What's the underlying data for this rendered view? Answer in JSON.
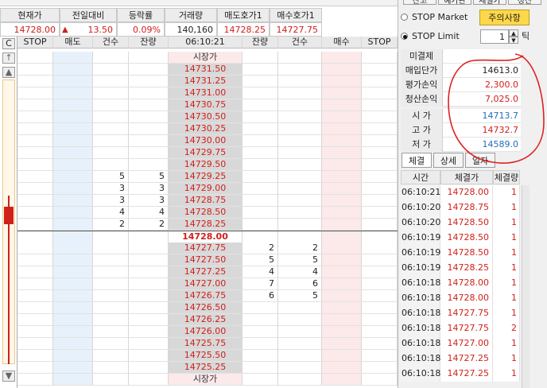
{
  "quote": {
    "headers": [
      "현재가",
      "전일대비",
      "등락률",
      "거래량",
      "매도호가1",
      "매수호가1"
    ],
    "current_price": "14728.00",
    "change_arrow": "▲",
    "change": "13.50",
    "change_rate": "0.09%",
    "volume": "140,160",
    "ask1": "14728.25",
    "bid1": "14727.75"
  },
  "orderbook": {
    "headers": [
      "STOP",
      "매도",
      "건수",
      "잔량",
      "06:10:21",
      "잔량",
      "건수",
      "매수",
      "STOP"
    ],
    "market_label": "시장가",
    "side_c_label": "C",
    "current": "14728.00",
    "asks": [
      {
        "price": "14731.50",
        "count": "",
        "qty": ""
      },
      {
        "price": "14731.25",
        "count": "",
        "qty": ""
      },
      {
        "price": "14731.00",
        "count": "",
        "qty": ""
      },
      {
        "price": "14730.75",
        "count": "",
        "qty": ""
      },
      {
        "price": "14730.50",
        "count": "",
        "qty": ""
      },
      {
        "price": "14730.25",
        "count": "",
        "qty": ""
      },
      {
        "price": "14730.00",
        "count": "",
        "qty": ""
      },
      {
        "price": "14729.75",
        "count": "",
        "qty": ""
      },
      {
        "price": "14729.50",
        "count": "",
        "qty": ""
      },
      {
        "price": "14729.25",
        "count": "5",
        "qty": "5"
      },
      {
        "price": "14729.00",
        "count": "3",
        "qty": "3"
      },
      {
        "price": "14728.75",
        "count": "3",
        "qty": "3"
      },
      {
        "price": "14728.50",
        "count": "4",
        "qty": "4"
      },
      {
        "price": "14728.25",
        "count": "2",
        "qty": "2"
      }
    ],
    "bids": [
      {
        "price": "14727.75",
        "qty": "2",
        "count": "2"
      },
      {
        "price": "14727.50",
        "qty": "5",
        "count": "5"
      },
      {
        "price": "14727.25",
        "qty": "4",
        "count": "4"
      },
      {
        "price": "14727.00",
        "qty": "7",
        "count": "6"
      },
      {
        "price": "14726.75",
        "qty": "6",
        "count": "5"
      },
      {
        "price": "14726.50",
        "qty": "",
        "count": ""
      },
      {
        "price": "14726.25",
        "qty": "",
        "count": ""
      },
      {
        "price": "14726.00",
        "qty": "",
        "count": ""
      },
      {
        "price": "14725.75",
        "qty": "",
        "count": ""
      },
      {
        "price": "14725.50",
        "qty": "",
        "count": ""
      },
      {
        "price": "14725.25",
        "qty": "",
        "count": ""
      }
    ]
  },
  "panel": {
    "stop_market": "STOP Market",
    "stop_limit": "STOP Limit",
    "notice_button": "주의사항",
    "tick_value": "1",
    "tick_unit": "틱",
    "top_tabs": [
      "잔고",
      "예가관",
      "체결가",
      "정산"
    ],
    "info": [
      {
        "label": "미결제",
        "value": "",
        "color": "#222222"
      },
      {
        "label": "매입단가",
        "value": "14613.0",
        "color": "#222222"
      },
      {
        "label": "평가손익",
        "value": "2,300.0",
        "color": "#d0201b"
      },
      {
        "label": "청산손익",
        "value": "7,025.0",
        "color": "#d0201b"
      },
      {
        "label": "시 가",
        "value": "14713.7",
        "color": "#1f6ebd"
      },
      {
        "label": "고 가",
        "value": "14732.7",
        "color": "#d0201b"
      },
      {
        "label": "저 가",
        "value": "14589.0",
        "color": "#1f6ebd"
      }
    ],
    "tabs": [
      "체결",
      "상세",
      "일자"
    ],
    "trade_headers": [
      "시간",
      "체결가",
      "체결량"
    ],
    "trades": [
      {
        "time": "06:10:21",
        "price": "14728.00",
        "qty": "1"
      },
      {
        "time": "06:10:20",
        "price": "14728.75",
        "qty": "1"
      },
      {
        "time": "06:10:20",
        "price": "14728.50",
        "qty": "1"
      },
      {
        "time": "06:10:19",
        "price": "14728.50",
        "qty": "1"
      },
      {
        "time": "06:10:19",
        "price": "14728.50",
        "qty": "1"
      },
      {
        "time": "06:10:19",
        "price": "14728.25",
        "qty": "1"
      },
      {
        "time": "06:10:18",
        "price": "14728.00",
        "qty": "1"
      },
      {
        "time": "06:10:18",
        "price": "14728.00",
        "qty": "1"
      },
      {
        "time": "06:10:18",
        "price": "14727.75",
        "qty": "1"
      },
      {
        "time": "06:10:18",
        "price": "14727.75",
        "qty": "2"
      },
      {
        "time": "06:10:18",
        "price": "14727.00",
        "qty": "1"
      },
      {
        "time": "06:10:18",
        "price": "14727.25",
        "qty": "1"
      },
      {
        "time": "06:10:18",
        "price": "14727.25",
        "qty": "1"
      }
    ]
  },
  "colors": {
    "ask_price": "#d0201b",
    "bid_price": "#d0201b",
    "annotation": "#e02020",
    "candle": "#d0201b"
  },
  "icons": [
    "up-arrow-icon",
    "down-arrow-icon",
    "scroll-up-icon",
    "scroll-down-icon",
    "radio-icon",
    "spin-up-icon",
    "spin-down-icon"
  ]
}
